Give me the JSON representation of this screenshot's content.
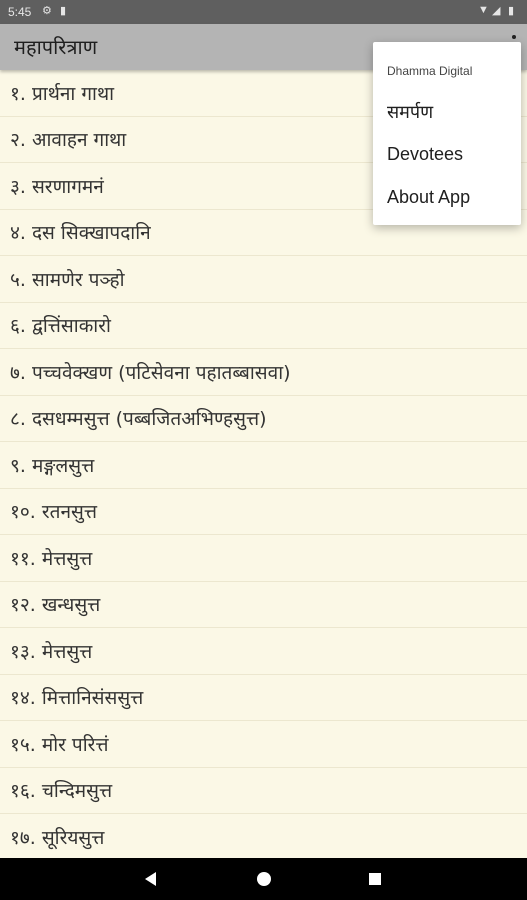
{
  "status_bar": {
    "time": "5:45",
    "icons": [
      "gear-icon",
      "sd-card-icon",
      "wifi-icon",
      "signal-icon",
      "battery-icon"
    ]
  },
  "app_bar": {
    "title": "महापरित्राण",
    "overflow_icon": "more-vert-icon"
  },
  "list": {
    "items": [
      "१. प्रार्थना गाथा",
      "२. आवाहन गाथा",
      "३. सरणागमनं",
      "४. दस सिक्खापदानि",
      "५. सामणेर पञ्हो",
      "६. द्वत्तिंसाकारो",
      "७. पच्चवेक्खण (पटिसेवना पहातब्बासवा)",
      "८. दसधम्मसुत्त (पब्बजितअभिण्हसुत्त)",
      "९. मङ्गलसुत्त",
      "१०. रतनसुत्त",
      "११. मेत्तसुत्त",
      "१२. खन्धसुत्त",
      "१३. मेत्तसुत्त",
      "१४. मित्तानिसंससुत्त",
      "१५. मोर परित्तं",
      "१६. चन्दिमसुत्त",
      "१७. सूरियसुत्त"
    ]
  },
  "menu": {
    "header": "Dhamma Digital",
    "items": [
      "समर्पण",
      "Devotees",
      "About App"
    ]
  },
  "nav_bar": {
    "icons": [
      "back-icon",
      "home-icon",
      "recents-icon"
    ]
  },
  "colors": {
    "background": "#fbf8e6",
    "app_bar": "#b4b4b4",
    "status_bar": "#5f5f5f"
  }
}
